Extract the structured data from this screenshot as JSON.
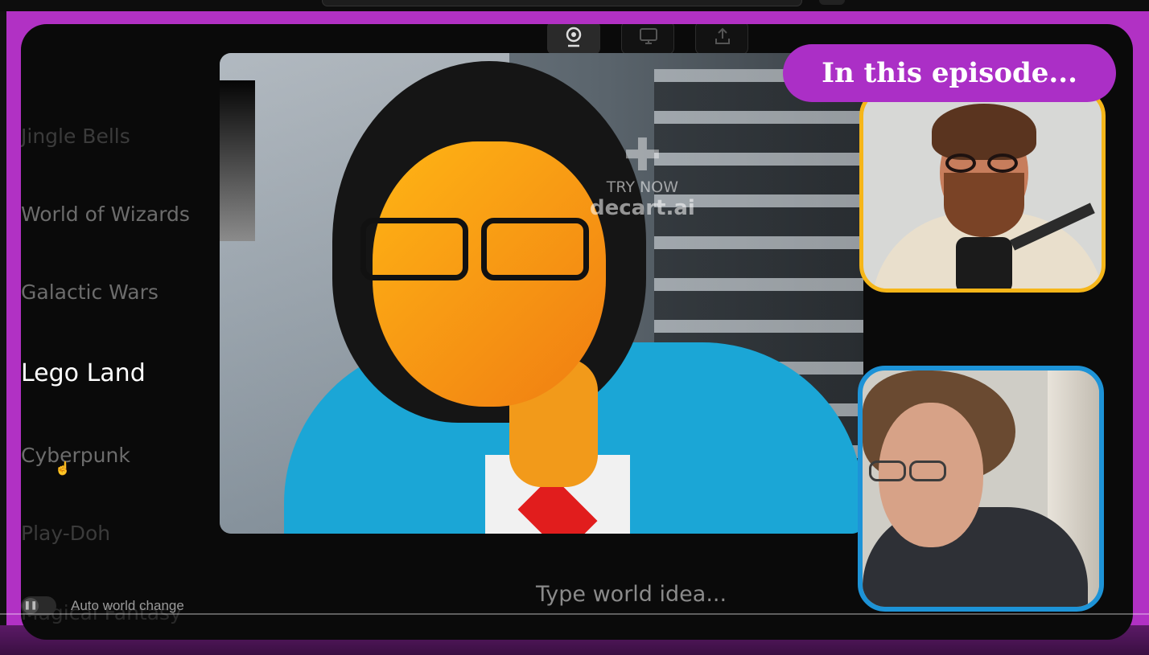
{
  "sidebar": {
    "worlds": [
      "Jingle Bells",
      "World of Wizards",
      "Galactic Wars",
      "Lego Land",
      "Cyberpunk",
      "Play-Doh",
      "Magical Fantasy"
    ],
    "active_world": "Lego Land",
    "auto_change_label": "Auto world change",
    "auto_change_enabled": false
  },
  "toolbar": {
    "buttons": [
      "webcam-icon",
      "screen-share-icon",
      "upload-icon"
    ],
    "active": "webcam-icon"
  },
  "video": {
    "watermark_cta": "TRY NOW",
    "watermark_brand": "decart.ai"
  },
  "input": {
    "placeholder": "Type world idea..."
  },
  "overlay": {
    "banner": "In this episode...",
    "cam1_border": "#f6b619",
    "cam2_border": "#1d93d7"
  },
  "colors": {
    "frame": "#b131c4",
    "banner": "#ab2fc6",
    "active_world": "#ffffff"
  }
}
